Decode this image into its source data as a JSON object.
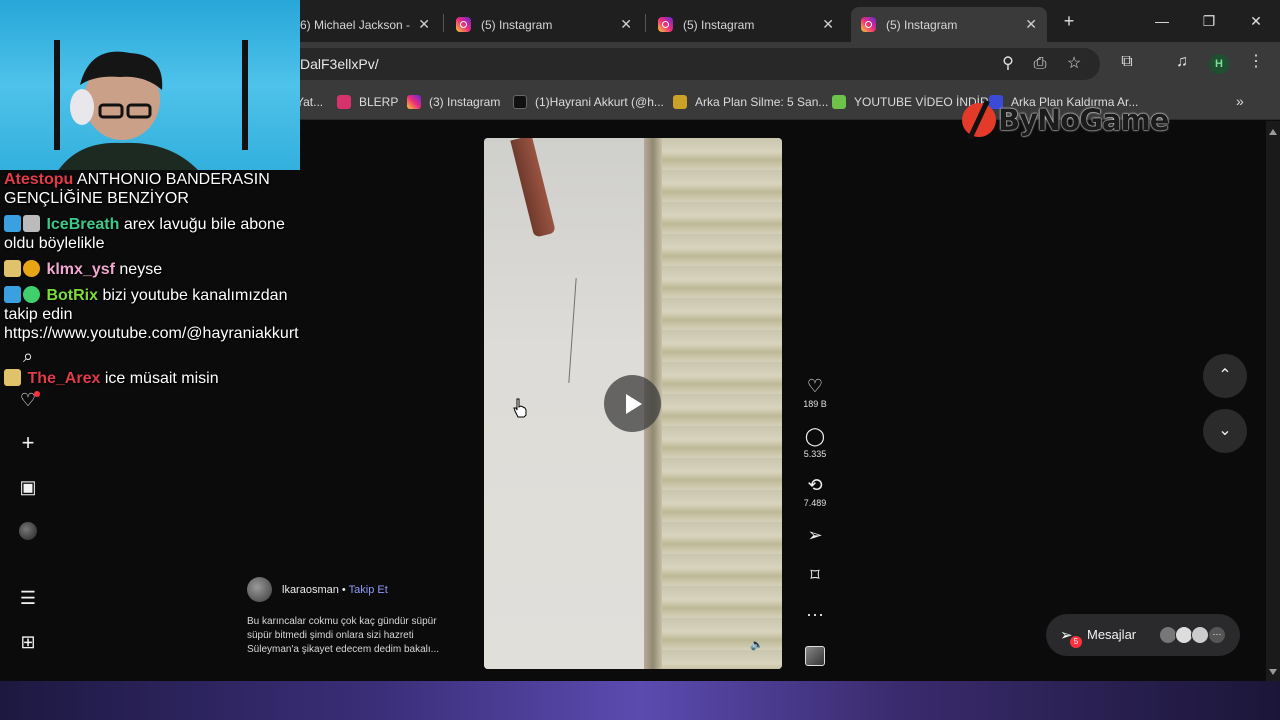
{
  "tabs": [
    {
      "title": "6) Michael Jackson - ",
      "active": false
    },
    {
      "title": "(5) Instagram",
      "active": false
    },
    {
      "title": "(5) Instagram",
      "active": false
    },
    {
      "title": "(5) Instagram",
      "active": true
    }
  ],
  "address": {
    "url": "DalF3ellxPv/",
    "profile_initial": "H"
  },
  "bookmarks": [
    {
      "label": "Yat...",
      "icon_color": "#888888"
    },
    {
      "label": "BLERP",
      "icon_color": "#d6336c"
    },
    {
      "label": "(3) Instagram",
      "icon_color": "#ee2a7b"
    },
    {
      "label": "(1)Hayrani Akkurt (@h...",
      "icon_color": "#111111"
    },
    {
      "label": "Arka Plan Silme: 5 San...",
      "icon_color": "#c9a227"
    },
    {
      "label": "YOUTUBE VİDEO İNDİR",
      "icon_color": "#6cc24a"
    },
    {
      "label": "Arka Plan Kaldırma Ar...",
      "icon_color": "#3a4bd8"
    }
  ],
  "chat": [
    {
      "user": "Atestopu",
      "user_color": "#e23b4a",
      "message": "ANTHONIO BANDERASIN GENÇLİĞİNE BENZİYOR"
    },
    {
      "user": "IceBreath",
      "user_color": "#3ec98a",
      "message": "arex lavuğu bile abone oldu böylelikle"
    },
    {
      "user": "klmx_ysf",
      "user_color": "#f2a7d0",
      "message": "neyse"
    },
    {
      "user": "BotRix",
      "user_color": "#7ddc3a",
      "message": "bizi youtube kanalımızdan takip edin https://www.youtube.com/@hayraniakkurt"
    },
    {
      "user": "The_Arex",
      "user_color": "#e23b4a",
      "message": "ice müsait misin"
    }
  ],
  "post": {
    "author": "lkaraosman",
    "separator": "•",
    "follow_label": "Takip Et",
    "caption": "Bu karıncalar cokmu çok kaç gündür süpür süpür bitmedi şimdi onlara sizi hazreti Süleyman'a şikayet edecem dedim bakalı..."
  },
  "actions": [
    {
      "name": "like",
      "icon": "heart-icon",
      "count": "189 B"
    },
    {
      "name": "comment",
      "icon": "comment-icon",
      "count": "5.335"
    },
    {
      "name": "repost",
      "icon": "repost-icon",
      "count": "7.489"
    },
    {
      "name": "share",
      "icon": "send-icon",
      "count": ""
    },
    {
      "name": "save",
      "icon": "bookmark-icon",
      "count": ""
    },
    {
      "name": "more",
      "icon": "more-icon",
      "count": ""
    }
  ],
  "messages": {
    "label": "Mesajlar",
    "unread": "5"
  },
  "watermark": {
    "text": "ByNoGame"
  },
  "colors": {
    "page_bg": "#0b0b0c",
    "follow_link": "#8f9bf7",
    "notification": "#ff3040",
    "tab_active": "#3a3a3a"
  }
}
